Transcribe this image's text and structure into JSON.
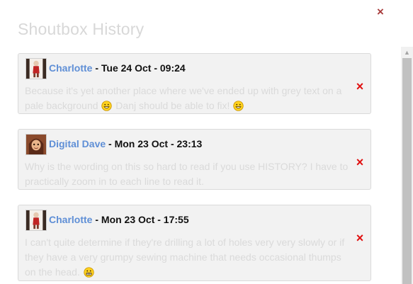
{
  "dialog": {
    "title": "Shoutbox History",
    "close_icon": "×"
  },
  "shouts": [
    {
      "author": "Charlotte",
      "separator": " - ",
      "date": "Tue 24 Oct - 09:24",
      "message_parts": [
        "Because it's yet another place where we've ended up with grey text on a pale background ",
        " Danj should be able to fix! "
      ],
      "avatar_icon": "avatar-charlotte",
      "emoticons": [
        "grin-smiley",
        "grin-smiley"
      ],
      "delete_icon": "×"
    },
    {
      "author": "Digital Dave",
      "separator": " - ",
      "date": "Mon 23 Oct - 23:13",
      "message": "Why is the wording on this so hard to read if you use HISTORY? I have to practically zoom in to each line to read it.",
      "avatar_icon": "avatar-digital-dave",
      "delete_icon": "×"
    },
    {
      "author": "Charlotte",
      "separator": " - ",
      "date": "Mon 23 Oct - 17:55",
      "message": "I can't quite determine if they're drilling a lot of holes very very slowly or if they have a very grumpy sewing machine that needs occasional thumps on the head. ",
      "avatar_icon": "avatar-charlotte",
      "emoticons": [
        "grimace-smiley"
      ],
      "delete_icon": "×"
    }
  ],
  "scrollbar": {
    "up_arrow": "▲"
  },
  "colors": {
    "author_link": "#5f8fd6",
    "delete": "#e01010",
    "faded_text": "#dadada"
  }
}
